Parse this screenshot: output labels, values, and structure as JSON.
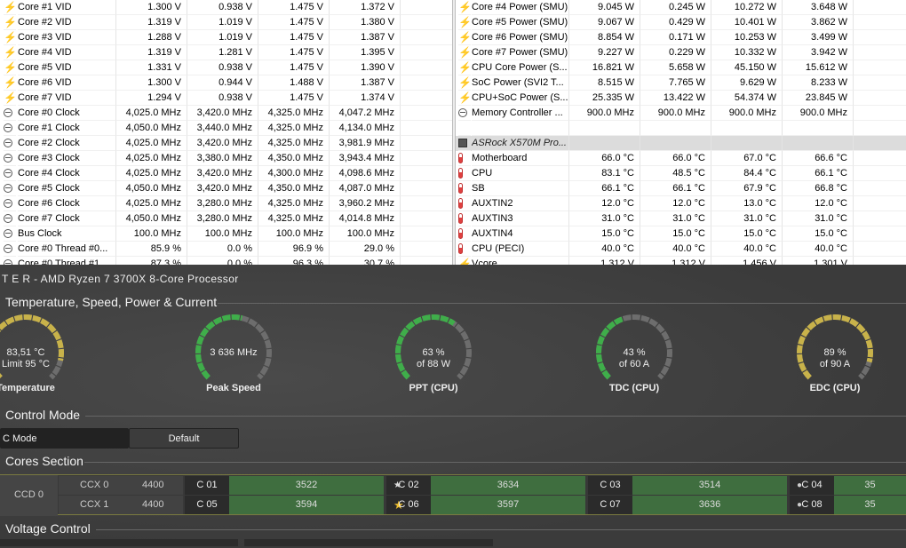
{
  "left_rows": [
    {
      "icon": "bolt-icon",
      "name": "Core #1 VID",
      "cur": "1.300 V",
      "min": "0.938 V",
      "max": "1.475 V",
      "avg": "1.372 V"
    },
    {
      "icon": "bolt-icon",
      "name": "Core #2 VID",
      "cur": "1.319 V",
      "min": "1.019 V",
      "max": "1.475 V",
      "avg": "1.380 V"
    },
    {
      "icon": "bolt-icon",
      "name": "Core #3 VID",
      "cur": "1.288 V",
      "min": "1.019 V",
      "max": "1.475 V",
      "avg": "1.387 V"
    },
    {
      "icon": "bolt-icon",
      "name": "Core #4 VID",
      "cur": "1.319 V",
      "min": "1.281 V",
      "max": "1.475 V",
      "avg": "1.395 V"
    },
    {
      "icon": "bolt-icon",
      "name": "Core #5 VID",
      "cur": "1.331 V",
      "min": "0.938 V",
      "max": "1.475 V",
      "avg": "1.390 V"
    },
    {
      "icon": "bolt-icon",
      "name": "Core #6 VID",
      "cur": "1.300 V",
      "min": "0.944 V",
      "max": "1.488 V",
      "avg": "1.387 V"
    },
    {
      "icon": "bolt-icon",
      "name": "Core #7 VID",
      "cur": "1.294 V",
      "min": "0.938 V",
      "max": "1.475 V",
      "avg": "1.374 V"
    },
    {
      "icon": "clock-icon",
      "name": "Core #0 Clock",
      "cur": "4,025.0 MHz",
      "min": "3,420.0 MHz",
      "max": "4,325.0 MHz",
      "avg": "4,047.2 MHz"
    },
    {
      "icon": "clock-icon",
      "name": "Core #1 Clock",
      "cur": "4,050.0 MHz",
      "min": "3,440.0 MHz",
      "max": "4,325.0 MHz",
      "avg": "4,134.0 MHz"
    },
    {
      "icon": "clock-icon",
      "name": "Core #2 Clock",
      "cur": "4,025.0 MHz",
      "min": "3,420.0 MHz",
      "max": "4,325.0 MHz",
      "avg": "3,981.9 MHz"
    },
    {
      "icon": "clock-icon",
      "name": "Core #3 Clock",
      "cur": "4,025.0 MHz",
      "min": "3,380.0 MHz",
      "max": "4,350.0 MHz",
      "avg": "3,943.4 MHz"
    },
    {
      "icon": "clock-icon",
      "name": "Core #4 Clock",
      "cur": "4,025.0 MHz",
      "min": "3,420.0 MHz",
      "max": "4,300.0 MHz",
      "avg": "4,098.6 MHz"
    },
    {
      "icon": "clock-icon",
      "name": "Core #5 Clock",
      "cur": "4,050.0 MHz",
      "min": "3,420.0 MHz",
      "max": "4,350.0 MHz",
      "avg": "4,087.0 MHz"
    },
    {
      "icon": "clock-icon",
      "name": "Core #6 Clock",
      "cur": "4,025.0 MHz",
      "min": "3,280.0 MHz",
      "max": "4,325.0 MHz",
      "avg": "3,960.2 MHz"
    },
    {
      "icon": "clock-icon",
      "name": "Core #7 Clock",
      "cur": "4,050.0 MHz",
      "min": "3,280.0 MHz",
      "max": "4,325.0 MHz",
      "avg": "4,014.8 MHz"
    },
    {
      "icon": "clock-icon",
      "name": "Bus Clock",
      "cur": "100.0 MHz",
      "min": "100.0 MHz",
      "max": "100.0 MHz",
      "avg": "100.0 MHz"
    },
    {
      "icon": "clock-icon",
      "name": "Core #0 Thread #0...",
      "cur": "85.9 %",
      "min": "0.0 %",
      "max": "96.9 %",
      "avg": "29.0 %"
    },
    {
      "icon": "clock-icon",
      "name": "Core #0 Thread #1...",
      "cur": "87.3 %",
      "min": "0.0 %",
      "max": "96.3 %",
      "avg": "30.7 %"
    }
  ],
  "right_rows": [
    {
      "icon": "bolt-icon",
      "name": "Core #4 Power (SMU)",
      "cur": "9.045 W",
      "min": "0.245 W",
      "max": "10.272 W",
      "avg": "3.648 W"
    },
    {
      "icon": "bolt-icon",
      "name": "Core #5 Power (SMU)",
      "cur": "9.067 W",
      "min": "0.429 W",
      "max": "10.401 W",
      "avg": "3.862 W"
    },
    {
      "icon": "bolt-icon",
      "name": "Core #6 Power (SMU)",
      "cur": "8.854 W",
      "min": "0.171 W",
      "max": "10.253 W",
      "avg": "3.499 W"
    },
    {
      "icon": "bolt-icon",
      "name": "Core #7 Power (SMU)",
      "cur": "9.227 W",
      "min": "0.229 W",
      "max": "10.332 W",
      "avg": "3.942 W"
    },
    {
      "icon": "bolt-icon",
      "name": "CPU Core Power (S...",
      "cur": "16.821 W",
      "min": "5.658 W",
      "max": "45.150 W",
      "avg": "15.612 W"
    },
    {
      "icon": "bolt-icon",
      "name": "SoC Power (SVI2 T...",
      "cur": "8.515 W",
      "min": "7.765 W",
      "max": "9.629 W",
      "avg": "8.233 W"
    },
    {
      "icon": "bolt-icon",
      "name": "CPU+SoC Power (S...",
      "cur": "25.335 W",
      "min": "13.422 W",
      "max": "54.374 W",
      "avg": "23.845 W"
    },
    {
      "icon": "clock-icon",
      "name": "Memory Controller ...",
      "cur": "900.0 MHz",
      "min": "900.0 MHz",
      "max": "900.0 MHz",
      "avg": "900.0 MHz"
    },
    {
      "icon": "none",
      "name": "",
      "cur": "",
      "min": "",
      "max": "",
      "avg": ""
    },
    {
      "icon": "chip-icon",
      "name": "ASRock X570M Pro...",
      "cur": "",
      "min": "",
      "max": "",
      "avg": "",
      "group": true
    },
    {
      "icon": "thermometer-icon",
      "name": "Motherboard",
      "cur": "66.0 °C",
      "min": "66.0 °C",
      "max": "67.0 °C",
      "avg": "66.6 °C"
    },
    {
      "icon": "thermometer-icon",
      "name": "CPU",
      "cur": "83.1 °C",
      "min": "48.5 °C",
      "max": "84.4 °C",
      "avg": "66.1 °C"
    },
    {
      "icon": "thermometer-icon",
      "name": "SB",
      "cur": "66.1 °C",
      "min": "66.1 °C",
      "max": "67.9 °C",
      "avg": "66.8 °C"
    },
    {
      "icon": "thermometer-icon",
      "name": "AUXTIN2",
      "cur": "12.0 °C",
      "min": "12.0 °C",
      "max": "13.0 °C",
      "avg": "12.0 °C"
    },
    {
      "icon": "thermometer-icon",
      "name": "AUXTIN3",
      "cur": "31.0 °C",
      "min": "31.0 °C",
      "max": "31.0 °C",
      "avg": "31.0 °C"
    },
    {
      "icon": "thermometer-icon",
      "name": "AUXTIN4",
      "cur": "15.0 °C",
      "min": "15.0 °C",
      "max": "15.0 °C",
      "avg": "15.0 °C"
    },
    {
      "icon": "thermometer-icon",
      "name": "CPU (PECI)",
      "cur": "40.0 °C",
      "min": "40.0 °C",
      "max": "40.0 °C",
      "avg": "40.0 °C"
    },
    {
      "icon": "bolt-icon",
      "name": "Vcore",
      "cur": "1.312 V",
      "min": "1.312 V",
      "max": "1.456 V",
      "avg": "1.301 V"
    }
  ],
  "rm": {
    "title": "T E R   -  AMD Ryzen 7 3700X 8-Core Processor",
    "section_temp": "Temperature, Speed, Power & Current",
    "section_control": "Control Mode",
    "section_cores": "Cores Section",
    "section_voltage": "Voltage Control",
    "control_mode_value": "C Mode",
    "control_mode_default": "Default",
    "gauges": [
      {
        "value": "83,51 °C",
        "sub": "Limit 95 °C",
        "label": "Temperature",
        "fraction": 0.88,
        "color": "#c8b24a"
      },
      {
        "value": "3 636  MHz",
        "sub": "",
        "label": "Peak Speed",
        "fraction": 0.55,
        "color": "#3fae4a"
      },
      {
        "value": "63 %",
        "sub": "of 88 W",
        "label": "PPT (CPU)",
        "fraction": 0.63,
        "color": "#3fae4a"
      },
      {
        "value": "43 %",
        "sub": "of 60 A",
        "label": "TDC (CPU)",
        "fraction": 0.43,
        "color": "#3fae4a"
      },
      {
        "value": "89 %",
        "sub": "of 90 A",
        "label": "EDC (CPU)",
        "fraction": 0.89,
        "color": "#c8b24a"
      }
    ],
    "ccd_label": "CCD 0",
    "ccx": [
      {
        "name": "CCX 0",
        "freq": "4400"
      },
      {
        "name": "CCX 1",
        "freq": "4400"
      }
    ],
    "cores": [
      {
        "name": "C 01",
        "value": "3522",
        "mark": ""
      },
      {
        "name": "C 02",
        "value": "3634",
        "mark": "star-white"
      },
      {
        "name": "C 03",
        "value": "3514",
        "mark": ""
      },
      {
        "name": "C 04",
        "value": "35",
        "mark": "dot"
      },
      {
        "name": "C 05",
        "value": "3594",
        "mark": ""
      },
      {
        "name": "C 06",
        "value": "3597",
        "mark": "star-gold"
      },
      {
        "name": "C 07",
        "value": "3636",
        "mark": ""
      },
      {
        "name": "C 08",
        "value": "35",
        "mark": "dot"
      }
    ]
  }
}
